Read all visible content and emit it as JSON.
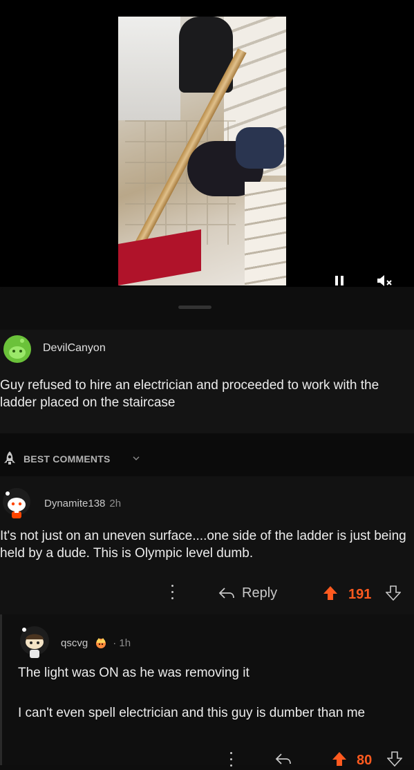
{
  "video": {
    "pause_icon": "pause-icon",
    "mute_icon": "speaker-muted-icon"
  },
  "post": {
    "avatar_icon": "green-snoo-avatar",
    "author": "DevilCanyon",
    "title": "Guy refused to hire an electrician and proceeded to work with the ladder placed on the staircase"
  },
  "sort": {
    "icon": "rocket-icon",
    "label": "BEST COMMENTS"
  },
  "comments": [
    {
      "author": "Dynamite138",
      "time": "2h",
      "body": "It's not just on an uneven surface....one side of the ladder is just being held by a dude. This is Olympic level dumb.",
      "reply_label": "Reply",
      "votes": "191"
    },
    {
      "author": "qscvg",
      "time": "· 1h",
      "body_1": "The light was ON as he was removing it",
      "body_2": "I can't even spell electrician and this guy is dumber than me",
      "votes": "80"
    }
  ],
  "colors": {
    "accent_upvote": "#ff5a1f",
    "background": "#0e0e0e",
    "avatar_green": "#6bc23a"
  }
}
